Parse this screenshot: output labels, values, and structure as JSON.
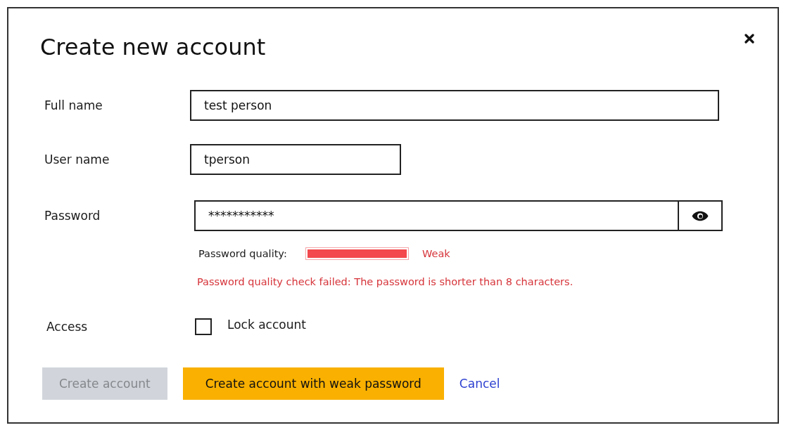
{
  "dialog": {
    "title": "Create new account"
  },
  "form": {
    "full_name": {
      "label": "Full name",
      "value": "test person"
    },
    "user_name": {
      "label": "User name",
      "value": "tperson"
    },
    "password": {
      "label": "Password",
      "value": "***********",
      "quality": {
        "label": "Password quality:",
        "level": 1,
        "rating": "Weak"
      },
      "error": "Password quality check failed: The password is shorter than 8 characters."
    },
    "access": {
      "label": "Access",
      "lock_account": {
        "label": "Lock account",
        "checked": false
      }
    }
  },
  "buttons": [
    {
      "kind": "primary",
      "label": "Create account",
      "disabled": true
    },
    {
      "kind": "warning",
      "label": "Create account with weak password",
      "disabled": false
    },
    {
      "kind": "link",
      "label": "Cancel",
      "disabled": false
    }
  ]
}
